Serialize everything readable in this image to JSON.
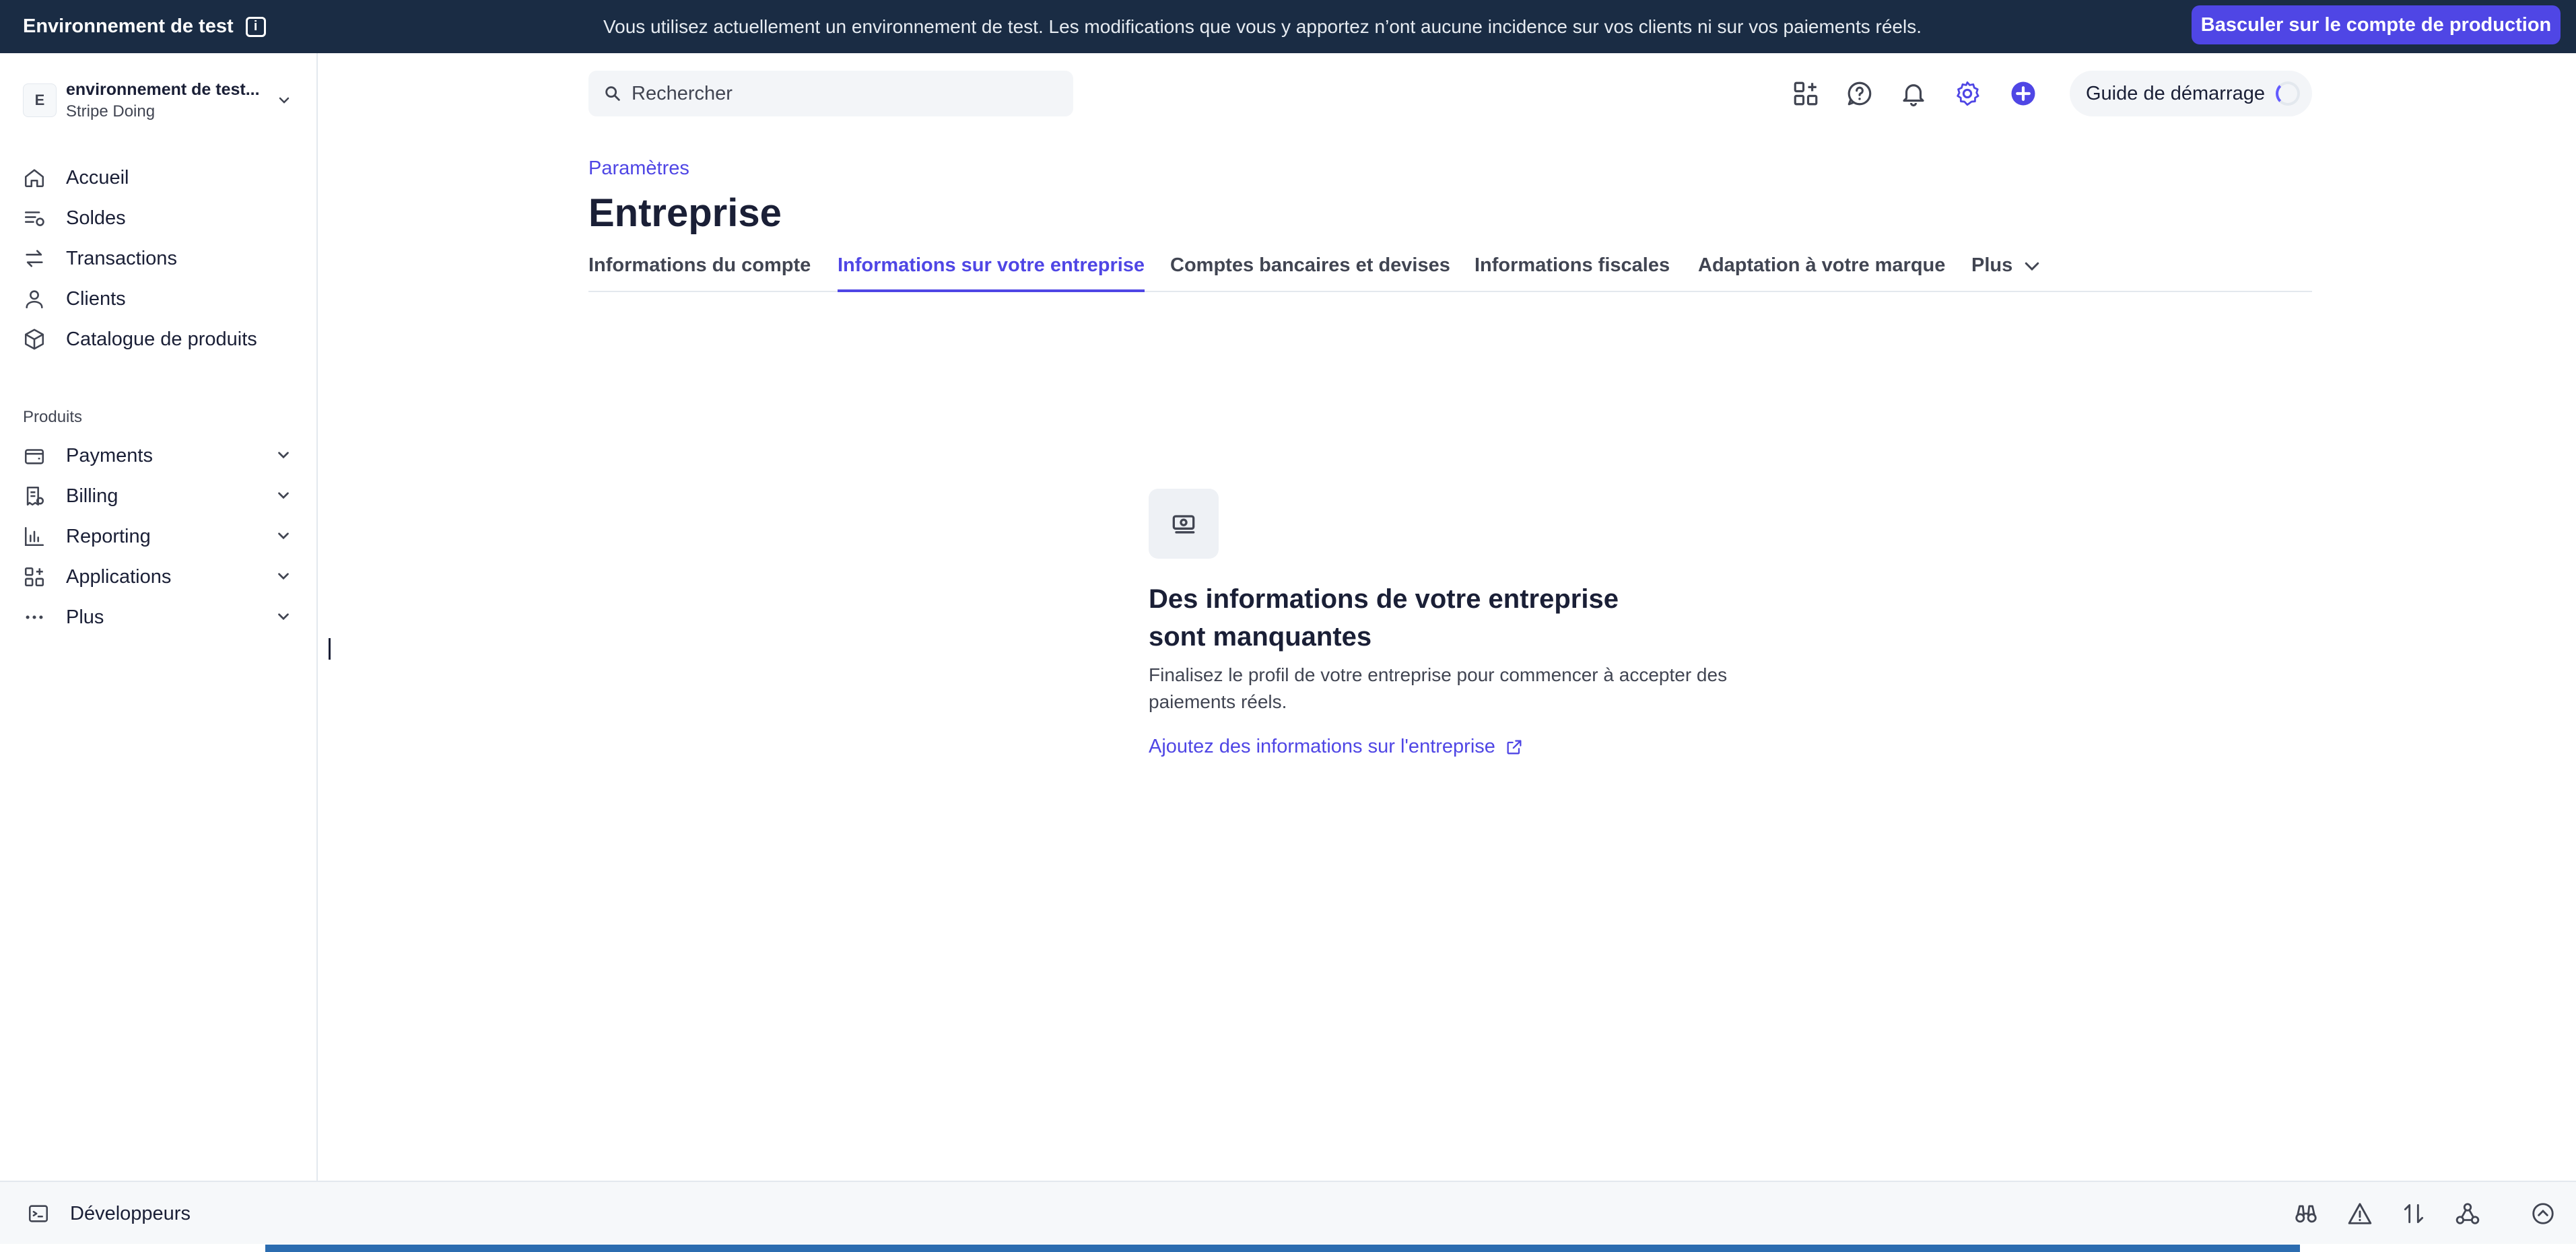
{
  "banner": {
    "title": "Environnement de test",
    "message": "Vous utilisez actuellement un environnement de test. Les modifications que vous y apportez n’ont aucune incidence sur vos clients ni sur vos paiements réels.",
    "switch_button": "Basculer sur le compte de production"
  },
  "account": {
    "avatar_letter": "E",
    "name": "environnement de test...",
    "subtitle": "Stripe Doing"
  },
  "sidebar": {
    "main_items": [
      {
        "label": "Accueil",
        "icon": "home-icon"
      },
      {
        "label": "Soldes",
        "icon": "balances-icon"
      },
      {
        "label": "Transactions",
        "icon": "transactions-icon"
      },
      {
        "label": "Clients",
        "icon": "person-icon"
      },
      {
        "label": "Catalogue de produits",
        "icon": "box-icon"
      }
    ],
    "products_label": "Produits",
    "product_items": [
      {
        "label": "Payments",
        "icon": "wallet-icon"
      },
      {
        "label": "Billing",
        "icon": "billing-icon"
      },
      {
        "label": "Reporting",
        "icon": "chart-icon"
      },
      {
        "label": "Applications",
        "icon": "apps-icon"
      },
      {
        "label": "Plus",
        "icon": "more-icon"
      }
    ]
  },
  "topbar": {
    "search_placeholder": "Rechercher",
    "guide_label": "Guide de démarrage"
  },
  "page": {
    "breadcrumb": "Paramètres",
    "title": "Entreprise",
    "tabs": [
      {
        "label": "Informations du compte",
        "active": false
      },
      {
        "label": "Informations sur votre entreprise",
        "active": true
      },
      {
        "label": "Comptes bancaires et devises",
        "active": false
      },
      {
        "label": "Informations fiscales",
        "active": false
      },
      {
        "label": "Adaptation à votre marque",
        "active": false
      },
      {
        "label": "Plus",
        "active": false
      }
    ]
  },
  "empty_state": {
    "title_line1": "Des informations de votre entreprise",
    "title_line2": "sont manquantes",
    "description_line1": "Finalisez le profil de votre entreprise pour commencer à accepter des",
    "description_line2": "paiements réels.",
    "link_label": "Ajoutez des informations sur l'entreprise"
  },
  "devbar": {
    "label": "Développeurs"
  },
  "colors": {
    "banner_bg": "#1a2c44",
    "accent": "#4f46e5",
    "devbar_bg": "#f6f8fa"
  }
}
